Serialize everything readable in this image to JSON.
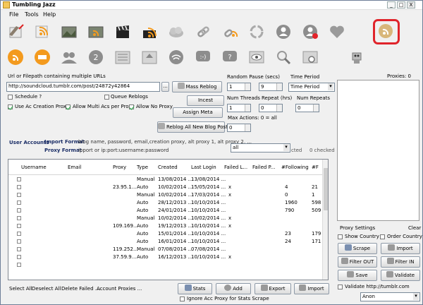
{
  "window": {
    "title": "Tumbling Jazz",
    "min": "_",
    "max": "□",
    "close": "X"
  },
  "menu": [
    "File",
    "Tools",
    "Help"
  ],
  "toolbar": {
    "row1": [
      "reblog-icon",
      "rss-icon",
      "photo-post-icon",
      "photo-rss-icon",
      "video-clapper-icon",
      "video-rss-icon",
      "cloud-upload-icon",
      "link-chain-icon",
      "link-rss-icon",
      "refresh-circle-icon",
      "user-icon",
      "user-remove-icon",
      "heart-icon",
      "rss-tag-icon"
    ],
    "row2": [
      "rss-stamp-icon",
      "notes-stamp-icon",
      "group-add-icon",
      "user-add-icon",
      "list-icon",
      "upload-list-icon",
      "wifi-icon",
      "smile-chat-icon",
      "help-chat-icon",
      "eye-icon",
      "search-icon",
      "photo-search-icon",
      "robot-icon"
    ]
  },
  "url": {
    "label": "Url or Filepath containing multiple URLs",
    "value": "http://soundcloud.tumblr.com/post/24872y42864",
    "browse": "..."
  },
  "options": {
    "schedule": "Schedule ?",
    "queue": "Queue Reblogs",
    "use_creation_proxy": "Use Ac Creation Proxy",
    "multi_accs": "Allow Multi Acs per Proxy",
    "no_proxy": "Allow No Proxy"
  },
  "actions": {
    "mass_reblog": "Mass Reblog",
    "incest": "Incest",
    "assign_meta": "Assign Meta",
    "reblog_all": "Reblog All New Blog Posts"
  },
  "random_pause": {
    "label": "Random Pause (secs)",
    "min": "1",
    "max": "9"
  },
  "time_period": {
    "label": "Time Period",
    "value": "Time Period"
  },
  "threads": {
    "label": "Num Threads",
    "value": "1"
  },
  "repeat": {
    "label": "Repeat (hrs)",
    "value": "0"
  },
  "num_repeats": {
    "label": "Num Repeats",
    "value": "0"
  },
  "max_actions": {
    "label": "Max Actions: 0 = all",
    "value": "0"
  },
  "proxies": {
    "label": "Proxies:",
    "count": "0"
  },
  "accounts": {
    "label": "User Accounts",
    "import_format_label": "Import Format",
    "import_format": "blog name, password, email,creation proxy, alt proxy 1, alt proxy 2, ...",
    "proxy_format_label": "Proxy Format",
    "proxy_format": "ipport  or  ip:port:username:password",
    "filter": "all",
    "selected": "cted",
    "checked": "0 checked"
  },
  "table": {
    "columns": [
      "Username",
      "Email",
      "Proxy",
      "Type",
      "Created",
      "Last Login",
      "Failed L...",
      "Failed P...",
      "#Following",
      "#F"
    ],
    "rows": [
      [
        "",
        "",
        "",
        "Manual",
        "13/08/2014 ...",
        "13/08/2014 ...",
        "",
        "",
        "",
        ""
      ],
      [
        "",
        "",
        "23.95.1...",
        "Auto",
        "10/02/2014 ...",
        "15/05/2014 ...",
        "x",
        "",
        "4",
        "21"
      ],
      [
        "",
        "",
        "",
        "Manual",
        "10/02/2014 ...",
        "17/03/2014 ...",
        "x",
        "",
        "0",
        "1"
      ],
      [
        "",
        "",
        "",
        "Auto",
        "28/12/2013 ...",
        "10/10/2014 ...",
        "",
        "",
        "1960",
        "598"
      ],
      [
        "",
        "",
        "",
        "Auto",
        "24/01/2014 ...",
        "10/10/2014 ...",
        "",
        "",
        "790",
        "509"
      ],
      [
        "",
        "",
        "",
        "Manual",
        "10/02/2014 ...",
        "10/02/2014 ...",
        "x",
        "",
        "",
        ""
      ],
      [
        "",
        "",
        "109.169...",
        "Auto",
        "19/12/2013 ...",
        "10/10/2014 ...",
        "x",
        "",
        "",
        ""
      ],
      [
        "",
        "",
        "",
        "Auto",
        "15/01/2014 ...",
        "10/10/2014 ...",
        "",
        "",
        "23",
        "179"
      ],
      [
        "",
        "",
        "",
        "Auto",
        "16/01/2014 ...",
        "10/10/2014 ...",
        "",
        "",
        "24",
        "171"
      ],
      [
        "",
        "",
        "119.252...",
        "Manual",
        "07/08/2014 ...",
        "07/08/2014 ...",
        "",
        "",
        "",
        ""
      ],
      [
        "",
        "",
        "37.59.9...",
        "Auto",
        "16/12/2013 ...",
        "10/10/2014 ...",
        "x",
        "",
        "",
        ""
      ],
      [
        "",
        "",
        "",
        "",
        "",
        "",
        "",
        "",
        "",
        ""
      ]
    ]
  },
  "bottom_links": [
    "Select All",
    "Deselect All",
    "Delete Failed ...",
    "Account Proxies ..."
  ],
  "bottom_buttons": {
    "stats": "Stats",
    "add": "Add",
    "export": "Export",
    "import": "Import",
    "ignore": "Ignore Acc Proxy for Stats Scrape"
  },
  "proxy_settings": {
    "label": "Proxy Settings",
    "clear": "Clear",
    "show_country": "Show Country",
    "order_country": "Order Country",
    "scrape": "Scrape",
    "import": "Import",
    "filter_out": "Filter OUT",
    "filter_in": "Filter IN",
    "save": "Save",
    "validate": "Validate",
    "validate_url": "Validate http://tumblr.com",
    "anon": "Anon"
  },
  "colors": {
    "accent_red": "#e3232a",
    "rss_orange": "#f39a1e",
    "highlight": "#e0242b"
  }
}
